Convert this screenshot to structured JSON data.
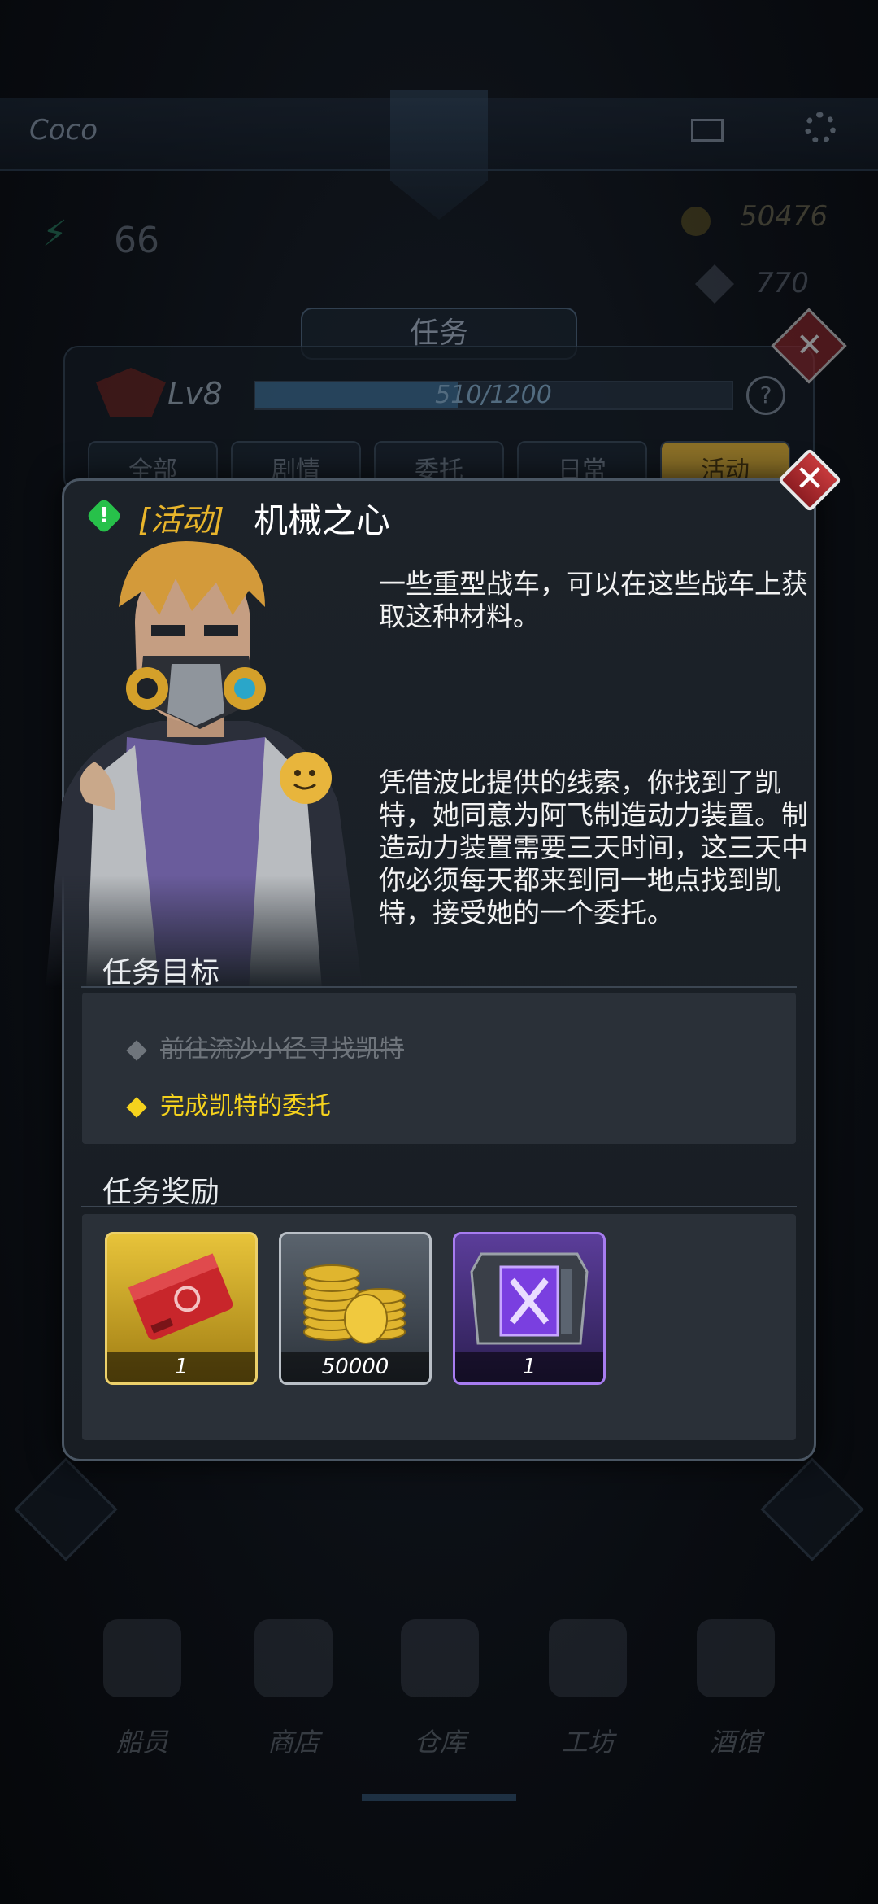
{
  "background": {
    "player_name": "Coco",
    "stat_value": "66",
    "gold": "50476",
    "gems": "770",
    "panel_title": "任务",
    "level": "Lv8",
    "xp_text": "510/1200",
    "xp_progress": 0.425,
    "help_label": "?",
    "tabs": [
      "全部",
      "剧情",
      "委托",
      "日常",
      "活动"
    ],
    "active_tab": "活动",
    "nav": [
      "船员",
      "商店",
      "仓库",
      "工坊",
      "酒馆"
    ]
  },
  "dialog": {
    "close_label": "✕",
    "alert_mark": "!",
    "tag": "[活动]",
    "title": "机械之心",
    "description_1": "一些重型战车，可以在这些战车上获取这种材料。",
    "description_2": "凭借波比提供的线索，你找到了凯特，她同意为阿飞制造动力装置。制造动力装置需要三天时间，这三天中你必须每天都来到同一地点找到凯特，接受她的一个委托。",
    "objectives_heading": "任务目标",
    "objectives": [
      {
        "text": "前往流沙小径寻找凯特",
        "done": true
      },
      {
        "text": "完成凯特的委托",
        "done": false
      }
    ],
    "rewards_heading": "任务奖励",
    "rewards": [
      {
        "icon": "red-ticket-icon",
        "count": "1",
        "frame": "gold"
      },
      {
        "icon": "gold-coins-icon",
        "count": "50000",
        "frame": "grey"
      },
      {
        "icon": "purple-crate-icon",
        "count": "1",
        "frame": "purple"
      }
    ]
  },
  "colors": {
    "tag": "#e8b52b",
    "objective_active": "#f5d21d",
    "objective_done": "#6f757c",
    "close_red": "#c63a3c",
    "alert_green": "#27c14a"
  }
}
